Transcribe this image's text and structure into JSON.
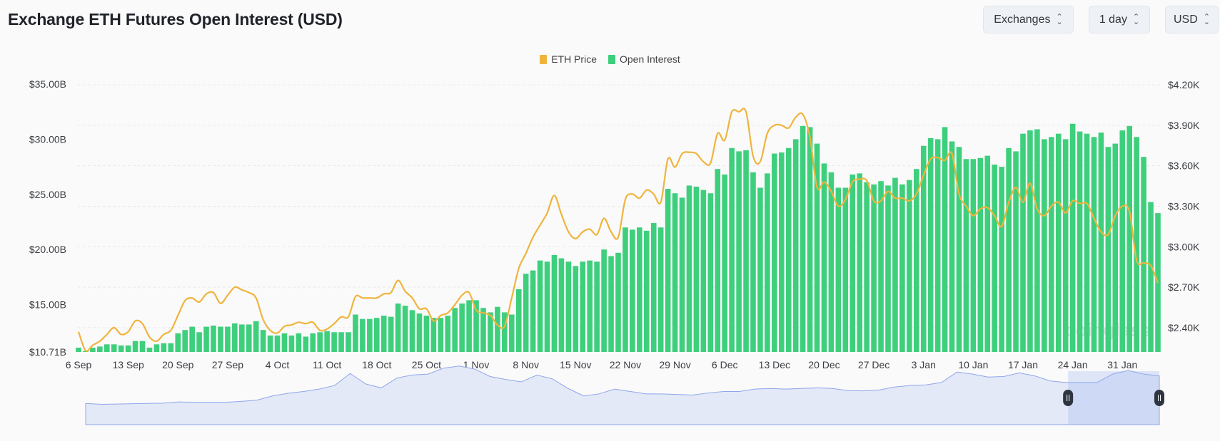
{
  "header": {
    "title": "Exchange ETH Futures Open Interest (USD)"
  },
  "controls": {
    "exchanges": "Exchanges",
    "interval": "1 day",
    "currency": "USD"
  },
  "watermark": "coinglass",
  "colors": {
    "eth_price": "#efb43e",
    "open_interest": "#3ecf7d",
    "navigator": "#8fa6ea"
  },
  "chart_data": {
    "type": "bar+line",
    "title": "",
    "legend": {
      "placement": "top-center",
      "entries": [
        "ETH Price",
        "Open Interest"
      ]
    },
    "grid": true,
    "left_axis": {
      "ticks": [
        "$35.00B",
        "$30.00B",
        "$25.00B",
        "$20.00B",
        "$15.00B",
        "$10.71B"
      ],
      "tick_values": [
        35,
        30,
        25,
        20,
        15,
        10.71
      ],
      "range": [
        10.71,
        35
      ],
      "unit": "B USD"
    },
    "right_axis": {
      "ticks": [
        "$4.20K",
        "$3.90K",
        "$3.60K",
        "$3.30K",
        "$3.00K",
        "$2.70K",
        "$2.40K"
      ],
      "tick_values": [
        4.2,
        3.9,
        3.6,
        3.3,
        3.0,
        2.7,
        2.4
      ],
      "range": [
        2.22,
        4.2
      ],
      "unit": "K USD"
    },
    "x_ticks": [
      "6 Sep",
      "13 Sep",
      "20 Sep",
      "27 Sep",
      "4 Oct",
      "11 Oct",
      "18 Oct",
      "25 Oct",
      "1 Nov",
      "8 Nov",
      "15 Nov",
      "22 Nov",
      "29 Nov",
      "6 Dec",
      "13 Dec",
      "20 Dec",
      "27 Dec",
      "3 Jan",
      "10 Jan",
      "17 Jan",
      "24 Jan",
      "31 Jan"
    ],
    "x_tick_every_days": 7,
    "series": [
      {
        "name": "Open Interest",
        "type": "bar",
        "axis": "left",
        "values": [
          11.1,
          10.8,
          11.1,
          11.2,
          11.4,
          11.4,
          11.3,
          11.3,
          11.7,
          11.7,
          11.1,
          11.4,
          11.5,
          11.5,
          12.4,
          12.7,
          13.0,
          12.5,
          13.0,
          13.1,
          13.0,
          13.0,
          13.3,
          13.2,
          13.2,
          13.5,
          12.7,
          12.2,
          12.2,
          12.4,
          12.2,
          12.4,
          12.1,
          12.4,
          12.5,
          12.6,
          12.5,
          12.5,
          12.5,
          14.1,
          13.7,
          13.7,
          13.8,
          14.0,
          13.9,
          15.1,
          14.9,
          14.5,
          14.2,
          14.0,
          13.8,
          13.8,
          14.0,
          14.7,
          15.1,
          15.4,
          15.4,
          14.7,
          14.3,
          14.8,
          14.3,
          14.1,
          16.4,
          17.8,
          18.1,
          19.0,
          18.9,
          19.5,
          19.2,
          18.9,
          18.5,
          18.9,
          19.0,
          18.9,
          20.0,
          19.4,
          19.7,
          22.0,
          21.8,
          22.0,
          21.7,
          22.4,
          22.0,
          25.5,
          25.1,
          24.7,
          25.8,
          25.7,
          25.4,
          25.1,
          27.3,
          26.8,
          29.2,
          28.9,
          29.0,
          27.0,
          25.6,
          26.9,
          28.7,
          28.8,
          29.2,
          30.0,
          31.2,
          31.1,
          29.6,
          27.8,
          27.0,
          25.6,
          25.6,
          26.8,
          26.9,
          26.1,
          25.9,
          26.2,
          25.8,
          26.5,
          25.9,
          26.3,
          27.3,
          29.4,
          30.1,
          30.0,
          31.1,
          29.8,
          29.3,
          28.2,
          28.2,
          28.3,
          28.5,
          27.7,
          27.5,
          29.2,
          28.9,
          30.5,
          30.8,
          30.9,
          30.0,
          30.2,
          30.5,
          30.0,
          31.4,
          30.7,
          30.5,
          30.2,
          30.6,
          29.3,
          29.6,
          30.8,
          31.2,
          30.2,
          28.4,
          24.3,
          23.3
        ]
      },
      {
        "name": "ETH Price",
        "type": "line",
        "axis": "right",
        "values": [
          2.37,
          2.23,
          2.27,
          2.3,
          2.35,
          2.4,
          2.35,
          2.37,
          2.45,
          2.43,
          2.33,
          2.3,
          2.35,
          2.38,
          2.49,
          2.6,
          2.62,
          2.59,
          2.65,
          2.66,
          2.58,
          2.64,
          2.7,
          2.68,
          2.66,
          2.62,
          2.46,
          2.38,
          2.36,
          2.41,
          2.42,
          2.44,
          2.43,
          2.44,
          2.38,
          2.39,
          2.43,
          2.48,
          2.48,
          2.63,
          2.62,
          2.62,
          2.62,
          2.65,
          2.66,
          2.75,
          2.67,
          2.62,
          2.54,
          2.54,
          2.45,
          2.49,
          2.51,
          2.57,
          2.64,
          2.66,
          2.53,
          2.51,
          2.49,
          2.42,
          2.41,
          2.62,
          2.84,
          2.95,
          3.07,
          3.16,
          3.25,
          3.38,
          3.24,
          3.11,
          3.06,
          3.11,
          3.13,
          3.09,
          3.21,
          3.11,
          3.07,
          3.35,
          3.39,
          3.36,
          3.42,
          3.39,
          3.33,
          3.65,
          3.59,
          3.69,
          3.7,
          3.69,
          3.63,
          3.62,
          3.84,
          3.79,
          4.0,
          4.0,
          4.0,
          3.67,
          3.63,
          3.84,
          3.9,
          3.9,
          3.88,
          3.96,
          3.98,
          3.81,
          3.44,
          3.48,
          3.41,
          3.3,
          3.35,
          3.48,
          3.5,
          3.49,
          3.34,
          3.34,
          3.41,
          3.36,
          3.36,
          3.34,
          3.39,
          3.53,
          3.65,
          3.66,
          3.64,
          3.69,
          3.39,
          3.3,
          3.23,
          3.28,
          3.29,
          3.23,
          3.15,
          3.33,
          3.44,
          3.33,
          3.47,
          3.28,
          3.23,
          3.3,
          3.33,
          3.25,
          3.34,
          3.32,
          3.32,
          3.21,
          3.11,
          3.09,
          3.23,
          3.3,
          3.26,
          2.9,
          2.88,
          2.86,
          2.73
        ]
      }
    ],
    "navigator": {
      "relative_values": [
        47,
        44,
        45,
        46,
        47,
        48,
        52,
        51,
        51,
        51,
        54,
        58,
        72,
        81,
        87,
        95,
        107,
        147,
        112,
        99,
        132,
        142,
        145,
        165,
        172,
        162,
        137,
        127,
        119,
        142,
        129,
        97,
        72,
        79,
        95,
        87,
        79,
        79,
        77,
        75,
        82,
        87,
        87,
        95,
        97,
        95,
        97,
        99,
        97,
        90,
        89,
        92,
        102,
        107,
        109,
        117,
        152,
        145,
        135,
        137,
        149,
        139,
        122,
        117,
        117,
        117,
        145,
        157,
        145,
        139
      ],
      "selected_fraction": [
        0.915,
        1.0
      ]
    }
  }
}
